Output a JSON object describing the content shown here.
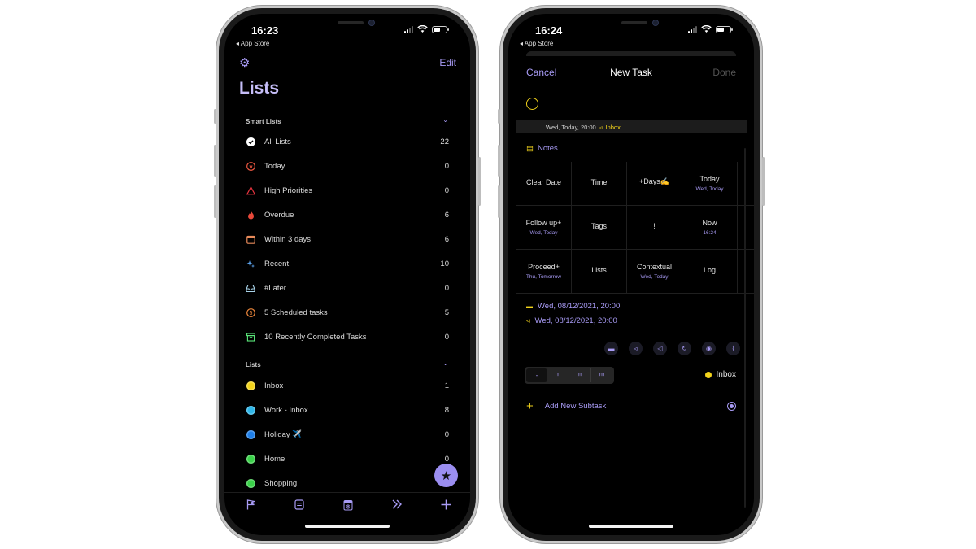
{
  "left": {
    "status": {
      "time": "16:23",
      "back": "◂ App Store"
    },
    "nav": {
      "edit": "Edit"
    },
    "title": "Lists",
    "smart_lists": {
      "header": "Smart Lists",
      "items": [
        {
          "label": "All Lists",
          "count": "22",
          "icon": "check-circle-icon",
          "color": "#ffffff"
        },
        {
          "label": "Today",
          "count": "0",
          "icon": "star-circle-icon",
          "color": "#e8553f"
        },
        {
          "label": "High Priorities",
          "count": "0",
          "icon": "warning-triangle-icon",
          "color": "#e8343f"
        },
        {
          "label": "Overdue",
          "count": "6",
          "icon": "flame-icon",
          "color": "#e8493a"
        },
        {
          "label": "Within 3 days",
          "count": "6",
          "icon": "calendar-icon",
          "color": "#e88a5a"
        },
        {
          "label": "Recent",
          "count": "10",
          "icon": "sparkle-icon",
          "color": "#5aa0e8"
        },
        {
          "label": "#Later",
          "count": "0",
          "icon": "tray-icon",
          "color": "#a8d2e8"
        },
        {
          "label": "5 Scheduled tasks",
          "count": "5",
          "icon": "number-five-icon",
          "color": "#e8843a"
        },
        {
          "label": "10 Recently Completed Tasks",
          "count": "0",
          "icon": "archive-box-icon",
          "color": "#5ae87a"
        }
      ]
    },
    "lists": {
      "header": "Lists",
      "items": [
        {
          "label": "Inbox",
          "count": "1",
          "color": "#f2d31b"
        },
        {
          "label": "Work - Inbox",
          "count": "8",
          "color": "#2fb6e8"
        },
        {
          "label": "Holiday ✈️",
          "count": "0",
          "color": "#1f7fe8"
        },
        {
          "label": "Home",
          "count": "0",
          "color": "#3bd14a"
        },
        {
          "label": "Shopping",
          "count": "",
          "color": "#3bd14a"
        }
      ]
    },
    "tabbar": {
      "calendar_day": "8"
    }
  },
  "right": {
    "status": {
      "time": "16:24",
      "back": "◂ App Store"
    },
    "nav": {
      "cancel": "Cancel",
      "title": "New Task",
      "done": "Done"
    },
    "meta": {
      "when": "Wed, Today, 20:00",
      "list": "Inbox"
    },
    "notes": "Notes",
    "quick_dates": [
      {
        "label": "Clear Date",
        "sub": ""
      },
      {
        "label": "Time",
        "sub": ""
      },
      {
        "label": "+Days✍️",
        "sub": ""
      },
      {
        "label": "Today",
        "sub": "Wed, Today"
      },
      {
        "label": "",
        "sub": ""
      },
      {
        "label": "Follow up+",
        "sub": "Wed, Today"
      },
      {
        "label": "Tags",
        "sub": ""
      },
      {
        "label": "!",
        "sub": ""
      },
      {
        "label": "Now",
        "sub": "16:24"
      },
      {
        "label": "",
        "sub": ""
      },
      {
        "label": "Proceed+",
        "sub": "Thu, Tomorrow"
      },
      {
        "label": "Lists",
        "sub": ""
      },
      {
        "label": "Contextual",
        "sub": "Wed, Today"
      },
      {
        "label": "Log",
        "sub": ""
      },
      {
        "label": "",
        "sub": ""
      }
    ],
    "due_date": "Wed, 08/12/2021, 20:00",
    "reminder": "Wed, 08/12/2021, 20:00",
    "priority_options": [
      "-",
      "!",
      "!!",
      "!!!"
    ],
    "list_name": "Inbox",
    "add_subtask": "Add New Subtask"
  }
}
